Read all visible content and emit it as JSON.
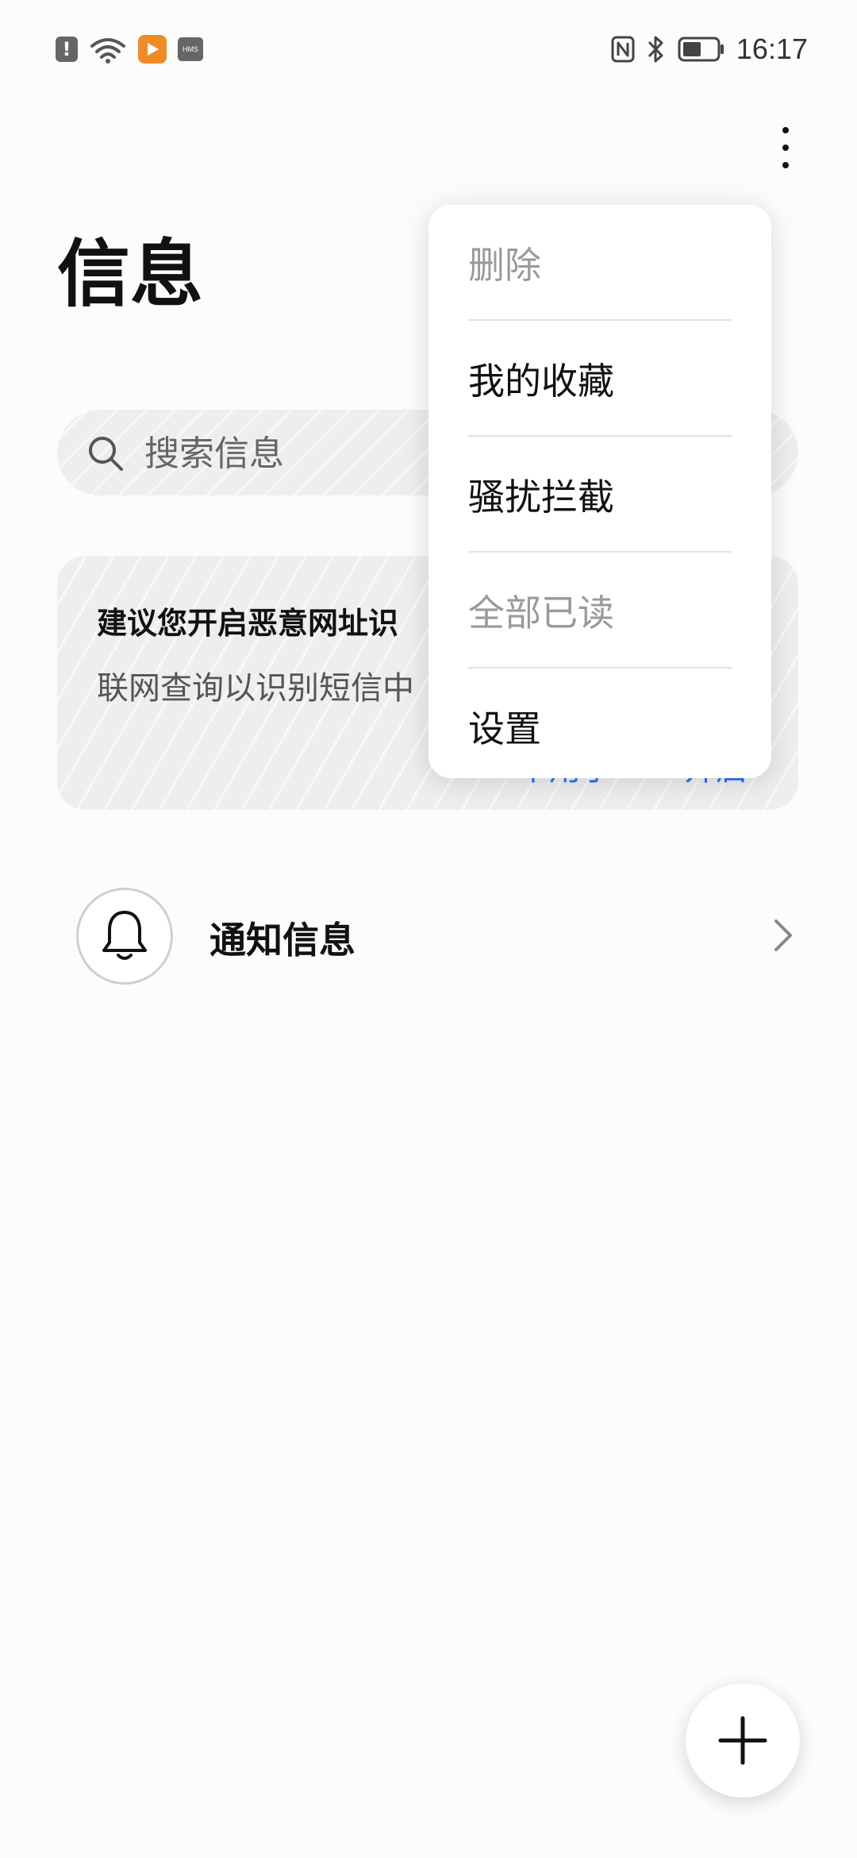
{
  "status_bar": {
    "alert_badge": "!",
    "icons": [
      "alert-icon",
      "wifi-icon",
      "video-app-icon",
      "hms-icon",
      "nfc-icon",
      "bluetooth-icon",
      "battery-icon"
    ],
    "hms_label": "HMS",
    "time": "16:17"
  },
  "header": {
    "title": "信息",
    "more_icon": "more-vertical-icon"
  },
  "search": {
    "placeholder": "搜索信息",
    "icon": "search-icon"
  },
  "suggestion_card": {
    "title": "建议您开启恶意网址识",
    "description": "联网查询以识别短信中",
    "ignore_label": "不用了",
    "enable_label": "开启"
  },
  "conversations": [
    {
      "label": "通知信息",
      "icon": "bell-icon"
    }
  ],
  "fab": {
    "icon": "plus-icon"
  },
  "menu": {
    "items": [
      {
        "label": "删除",
        "enabled": false
      },
      {
        "label": "我的收藏",
        "enabled": true
      },
      {
        "label": "骚扰拦截",
        "enabled": true
      },
      {
        "label": "全部已读",
        "enabled": false
      },
      {
        "label": "设置",
        "enabled": true
      }
    ]
  },
  "colors": {
    "accent": "#256fff",
    "disabled_text": "#9a9a9a",
    "card_bg": "#eeeeee",
    "page_bg": "#fcfcfc"
  }
}
